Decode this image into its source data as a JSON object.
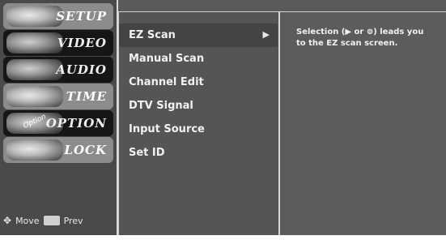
{
  "menu": {
    "items": [
      {
        "label": "SETUP",
        "icon": "setup-icon"
      },
      {
        "label": "VIDEO",
        "icon": "video-icon"
      },
      {
        "label": "AUDIO",
        "icon": "audio-icon"
      },
      {
        "label": "TIME",
        "icon": "time-icon"
      },
      {
        "label": "OPTION",
        "icon": "option-icon"
      },
      {
        "label": "LOCK",
        "icon": "lock-icon"
      }
    ],
    "option_tag": "Option"
  },
  "hints": {
    "move_icon": "dpad-icon",
    "move_label": "Move",
    "prev_icon": "menu-key-icon",
    "prev_label": "Prev"
  },
  "submenu": {
    "items": [
      {
        "label": "EZ Scan"
      },
      {
        "label": "Manual Scan"
      },
      {
        "label": "Channel Edit"
      },
      {
        "label": "DTV Signal"
      },
      {
        "label": "Input Source"
      },
      {
        "label": "Set ID"
      }
    ],
    "selected_arrow": "▶"
  },
  "help": {
    "text": "Selection (▶ or ⊚) leads you to the EZ scan screen."
  },
  "colors": {
    "screen_bg": "#5a5a5a",
    "menu_bg": "#4a4a4a",
    "panel_bg": "#5c5c5c",
    "text": "#f0f0f0"
  }
}
